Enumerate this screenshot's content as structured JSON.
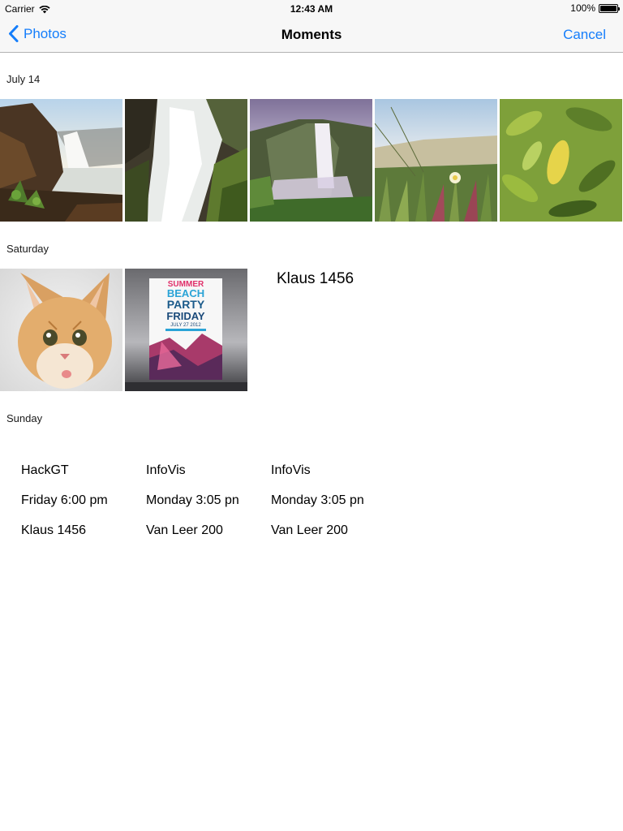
{
  "status_bar": {
    "carrier": "Carrier",
    "time": "12:43 AM",
    "battery": "100%",
    "battery_level": 1.0,
    "wifi_icon": "wifi-icon",
    "battery_icon": "battery-icon"
  },
  "nav": {
    "back_label": "Photos",
    "title": "Moments",
    "cancel_label": "Cancel",
    "accent_color": "#157efb",
    "back_icon": "chevron-left-icon"
  },
  "sections": [
    {
      "title": "July 14"
    },
    {
      "title": "Saturday"
    },
    {
      "title": "Sunday"
    }
  ],
  "saturday_note": "Klaus 1456",
  "events": [
    {
      "name": "HackGT",
      "time": "Friday 6:00 pm",
      "location": "Klaus 1456"
    },
    {
      "name": "InfoVis",
      "time": "Monday 3:05 pn",
      "location": "Van Leer 200"
    },
    {
      "name": "InfoVis",
      "time": "Monday 3:05 pn",
      "location": "Van Leer 200"
    }
  ],
  "poster": {
    "line1": "SUMMER",
    "line2": "BEACH",
    "line3": "PARTY",
    "line4": "FRIDAY",
    "line5": "JULY 27 2012"
  }
}
